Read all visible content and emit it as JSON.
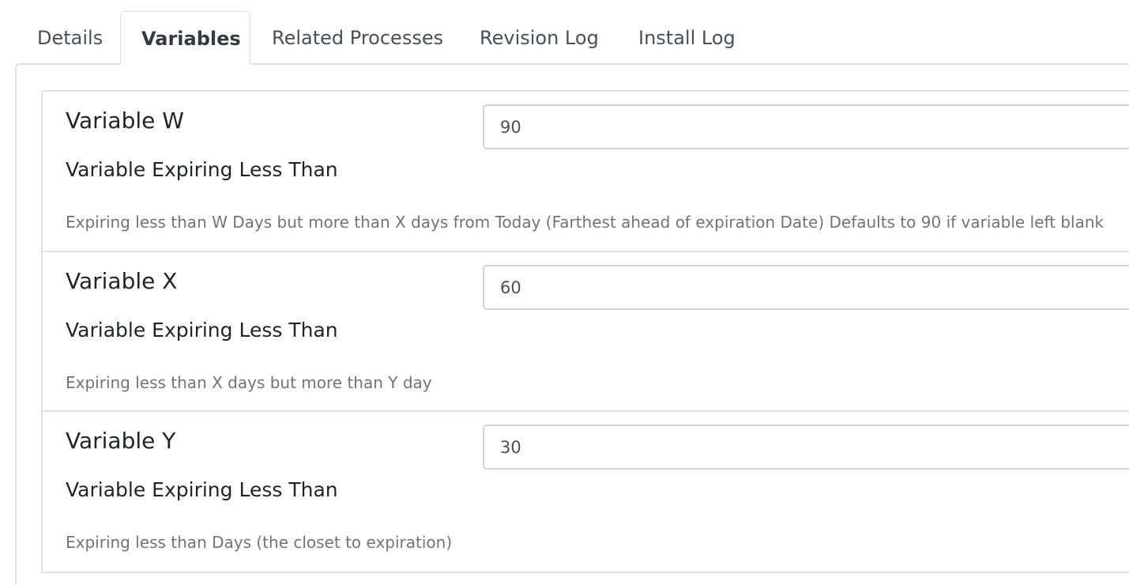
{
  "tabs": [
    {
      "label": "Details",
      "active": false
    },
    {
      "label": "Variables",
      "active": true
    },
    {
      "label": "Related Processes",
      "active": false
    },
    {
      "label": "Revision Log",
      "active": false
    },
    {
      "label": "Install Log",
      "active": false
    }
  ],
  "variables": [
    {
      "name": "Variable W",
      "label": "Variable Expiring Less Than",
      "value": "90",
      "description": "Expiring less than W Days but more than X days from Today (Farthest ahead of expiration Date) Defaults to 90 if variable left blank"
    },
    {
      "name": "Variable X",
      "label": "Variable Expiring Less Than",
      "value": "60",
      "description": "Expiring less than X days but more than Y day"
    },
    {
      "name": "Variable Y",
      "label": "Variable Expiring Less Than",
      "value": "30",
      "description": "Expiring less than Days (the closet to expiration)"
    }
  ]
}
